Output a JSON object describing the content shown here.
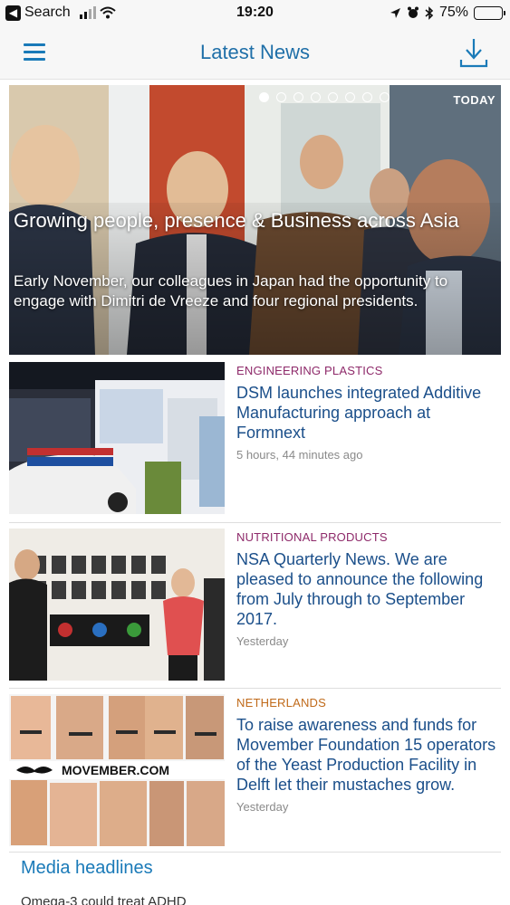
{
  "status_bar": {
    "back_label": "Search",
    "time": "19:20",
    "battery": "75%",
    "battery_level": 0.75
  },
  "header": {
    "title": "Latest News",
    "menu_icon": "hamburger-menu-icon",
    "download_icon": "download-icon"
  },
  "hero": {
    "badge": "TODAY",
    "title": "Growing people, presence & Business across Asia",
    "summary": "Early November, our colleagues in Japan had the opportunity to engage with Dimitri de Vreeze and four regional presidents.",
    "slides_total": 8,
    "active_slide": 1
  },
  "news": [
    {
      "category": "ENGINEERING PLASTICS",
      "category_color": "#8e2a6a",
      "headline": "DSM launches integrated Additive Manufacturing approach at Formnext",
      "time": "5 hours, 44 minutes ago"
    },
    {
      "category": "NUTRITIONAL PRODUCTS",
      "category_color": "#8e2a6a",
      "headline": "NSA Quarterly News. We are pleased to announce the following from July through to September 2017.",
      "time": "Yesterday"
    },
    {
      "category": "NETHERLANDS",
      "category_color": "#c06a1a",
      "headline": "To raise awareness and funds for Movember Foundation 15 operators of the Yeast Production Facility in Delft let their mustaches grow.",
      "time": "Yesterday",
      "image_text": "MOVEMBER.COM"
    }
  ],
  "media": {
    "title": "Media headlines",
    "first_item": "Omega-3 could treat ADHD"
  },
  "colors": {
    "accent": "#1a7ab8",
    "headline": "#1b4f8a"
  }
}
